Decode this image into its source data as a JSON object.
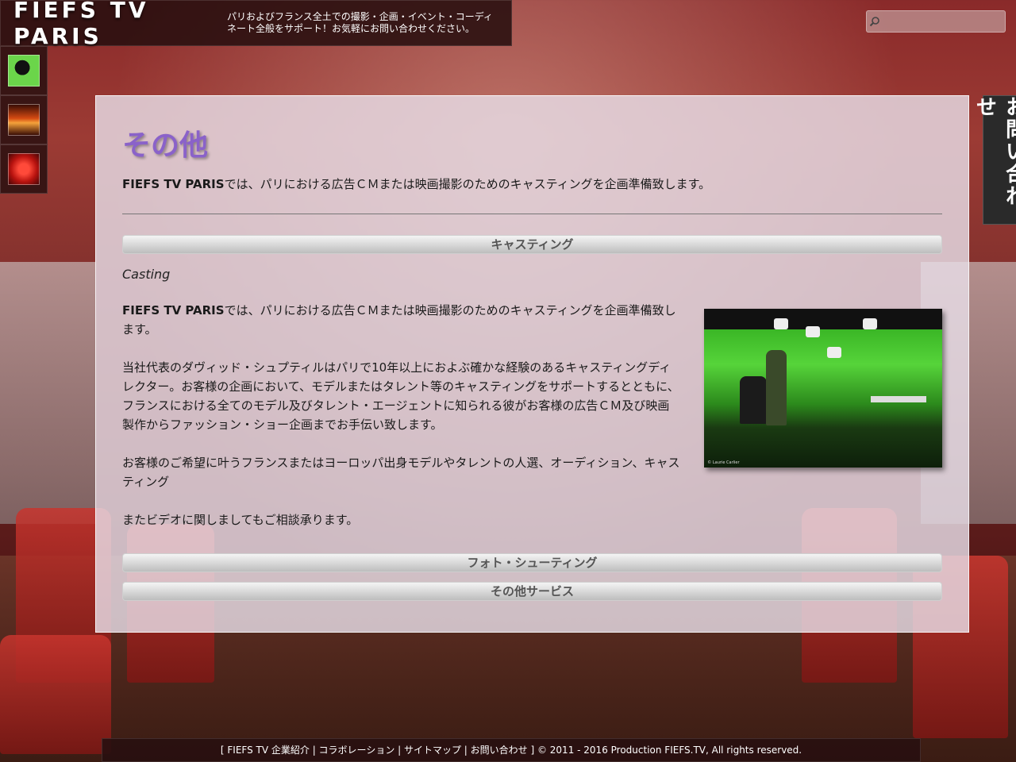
{
  "header": {
    "site_title": "FIEFS TV PARIS",
    "tagline": "パリおよびフランス全土での撮影・企画・イベント・コーディネート全般をサポート！お気軽にお問い合わせください。"
  },
  "search": {
    "placeholder": "",
    "icon": "search-icon"
  },
  "contact_tab": {
    "label": "お問い合わせ"
  },
  "main": {
    "title": "その他",
    "intro_brand": "FIEFS TV PARIS",
    "intro_text": "では、パリにおける広告ＣＭまたは映画撮影のためのキャスティングを企画準備致します。",
    "sections": [
      {
        "label": "キャスティング"
      },
      {
        "label": "フォト・シューティング"
      },
      {
        "label": "その他サービス"
      }
    ],
    "casting": {
      "subtitle": "Casting",
      "p1_brand": "FIEFS TV PARIS",
      "p1_text": "では、パリにおける広告ＣＭまたは映画撮影のためのキャスティングを企画準備致します。",
      "p2": "当社代表のダヴィッド・シュプティルはパリで10年以上におよぶ確かな経験のあるキャスティングディレクター。お客様の企画において、モデルまたはタレント等のキャスティングをサポートするとともに、フランスにおける全てのモデル及びタレント・エージェントに知られる彼がお客様の広告ＣＭ及び映画製作からファッション・ショー企画までお手伝い致します。",
      "p3": "お客様のご希望に叶うフランスまたはヨーロッパ出身モデルやタレントの人選、オーディション、キャスティング",
      "p4": "またビデオに関しましてもご相談承ります。",
      "photo_caption": "© Laurie Carlier"
    }
  },
  "footer": {
    "text": "[ FIEFS TV 企業紹介 | コラボレーション | サイトマップ | お問い合わせ ] © 2011 - 2016 Production FIEFS.TV, All rights reserved."
  }
}
